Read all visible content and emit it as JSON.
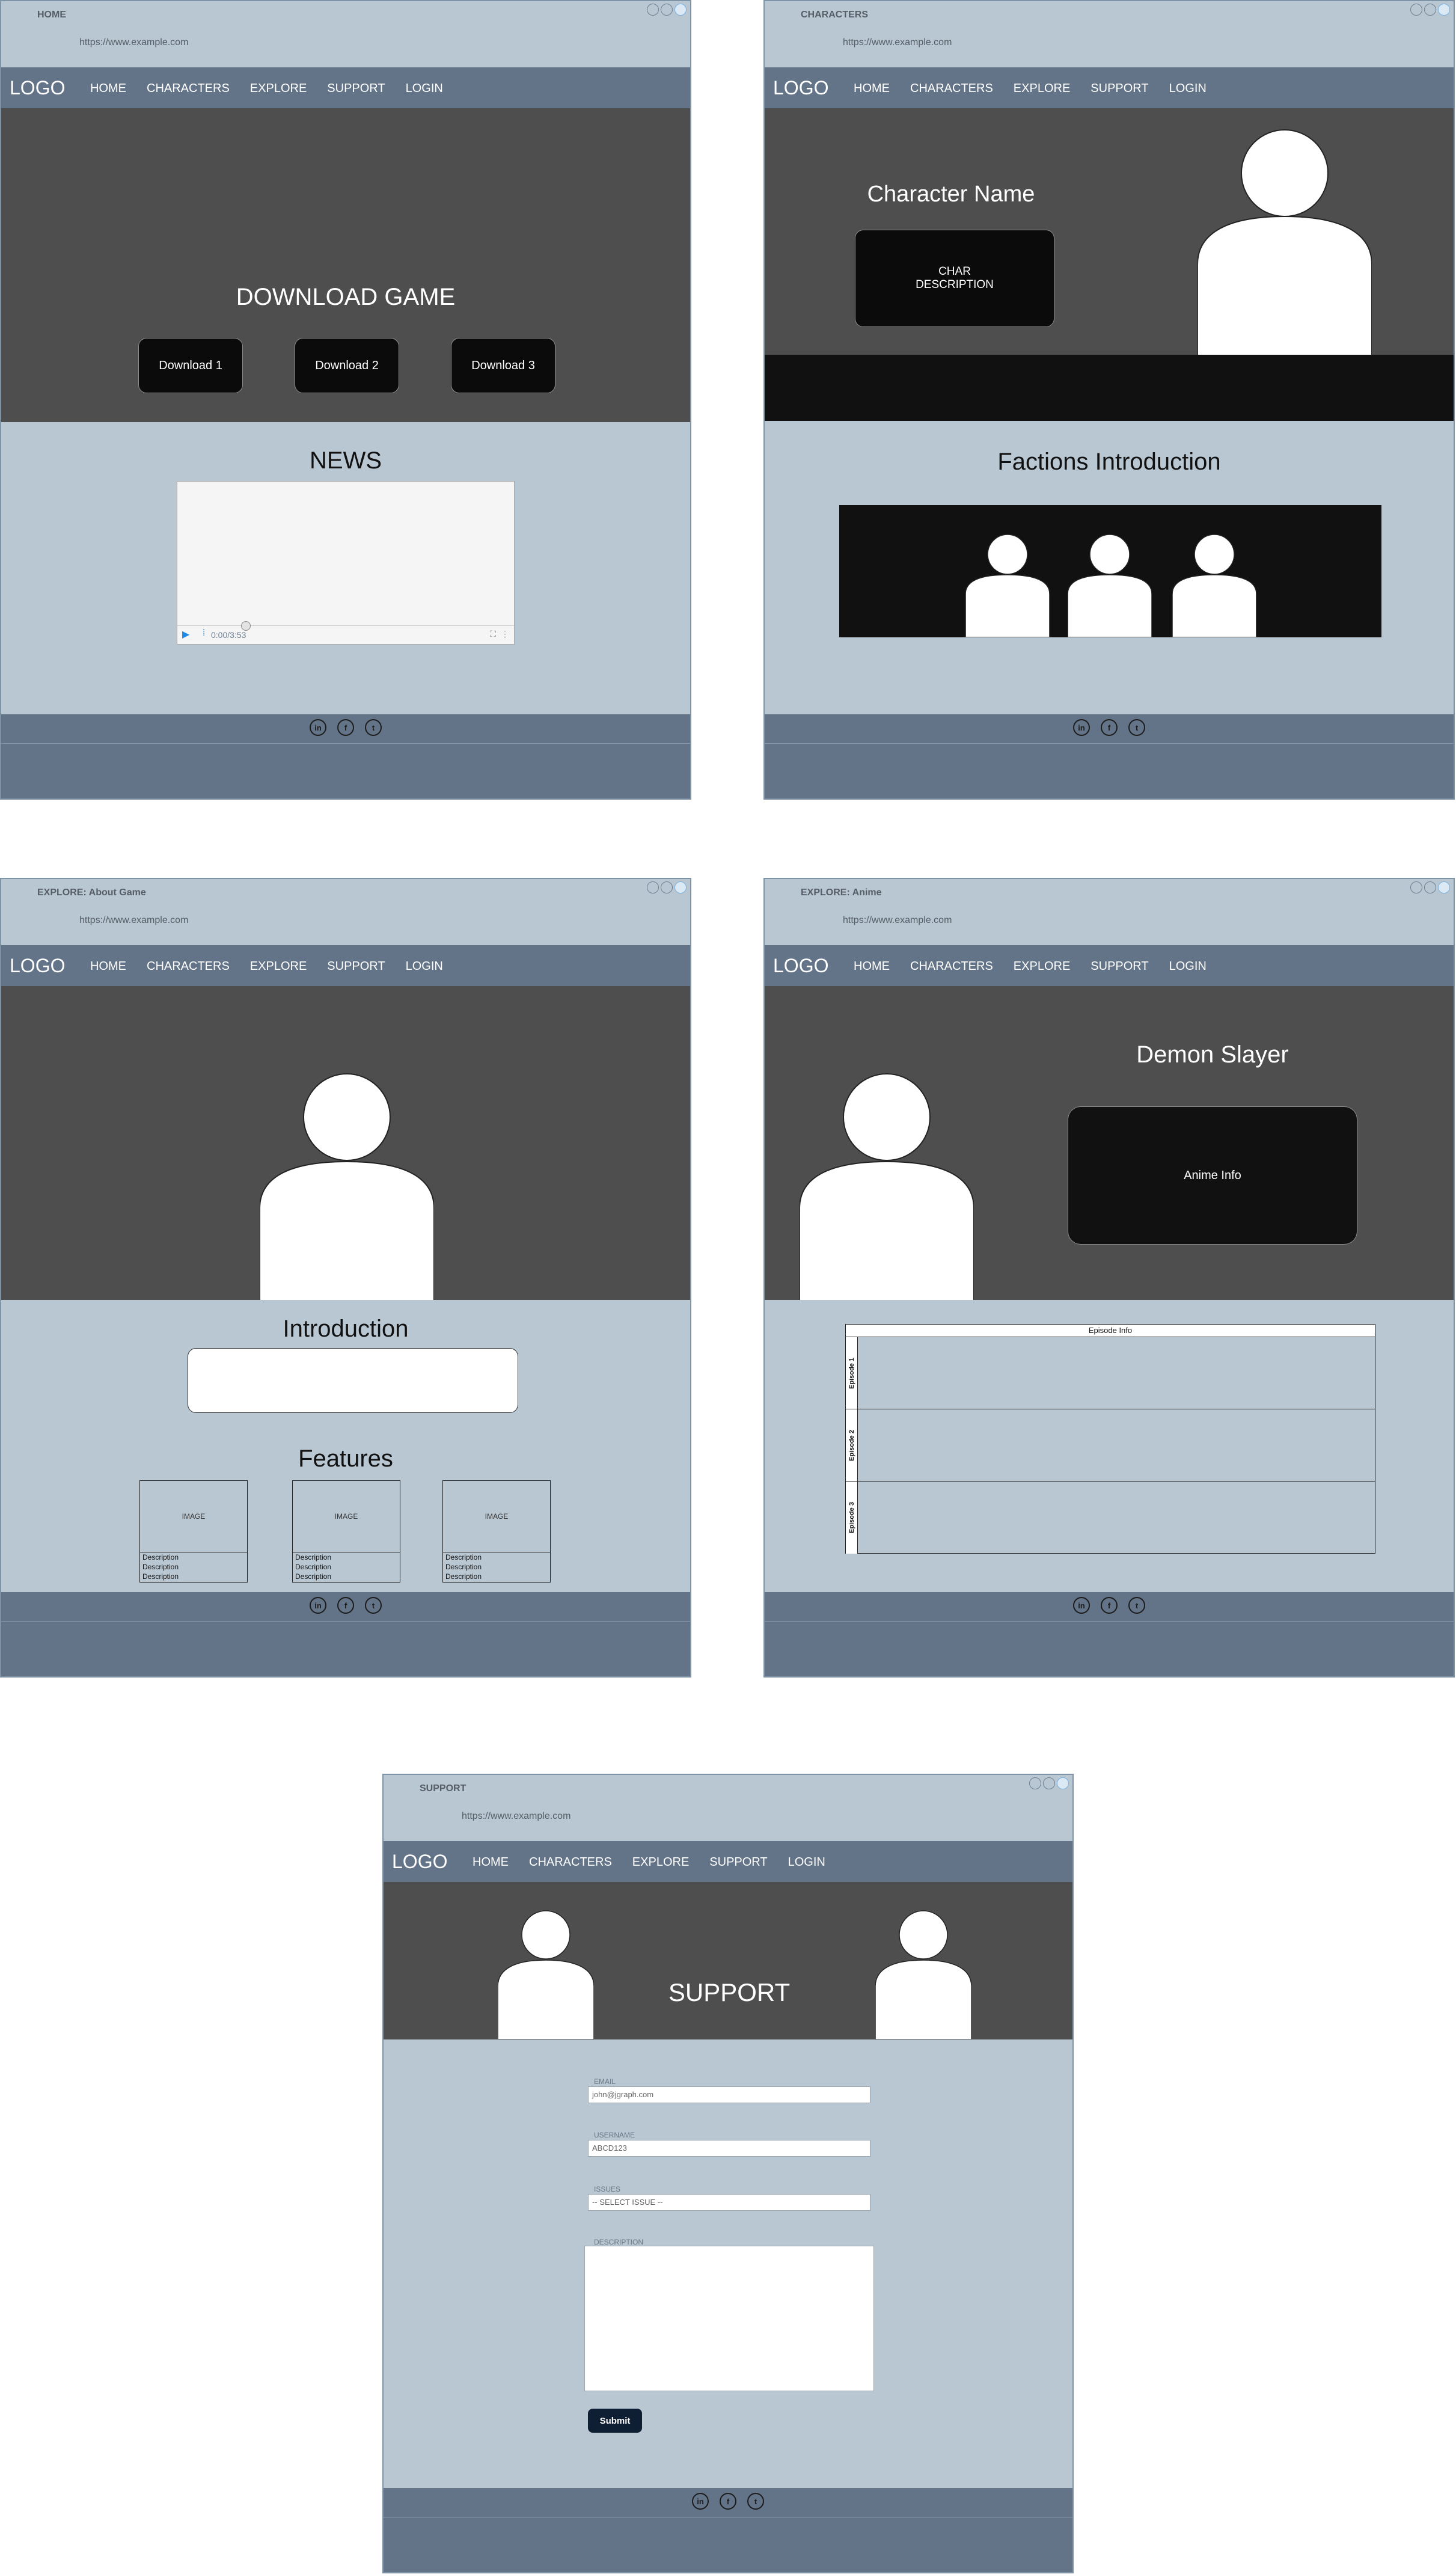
{
  "common": {
    "url": "https://www.example.com",
    "logo": "LOGO",
    "nav": [
      "HOME",
      "CHARACTERS",
      "EXPLORE",
      "SUPPORT",
      "LOGIN"
    ],
    "social": [
      "in",
      "f",
      "t"
    ]
  },
  "home": {
    "title": "HOME",
    "hero_heading": "DOWNLOAD GAME",
    "downloads": [
      "Download 1",
      "Download 2",
      "Download 3"
    ],
    "news_heading": "NEWS",
    "video_time": "0:00/3:53"
  },
  "characters": {
    "title": "CHARACTERS",
    "character_name": "Character Name",
    "char_desc_line1": "CHAR",
    "char_desc_line2": "DESCRIPTION",
    "factions_heading": "Factions Introduction"
  },
  "about": {
    "title": "EXPLORE: About Game",
    "intro_heading": "Introduction",
    "features_heading": "Features",
    "feature_image": "IMAGE",
    "feature_desc": "Description"
  },
  "anime": {
    "title": "EXPLORE: Anime",
    "anime_title": "Demon Slayer",
    "anime_info": "Anime Info",
    "episode_header": "Episode Info",
    "episodes": [
      "Episode 1",
      "Episode 2",
      "Episode 3"
    ]
  },
  "support": {
    "title": "SUPPORT",
    "hero_heading": "SUPPORT",
    "email_label": "EMAIL",
    "email_value": "john@jgraph.com",
    "username_label": "USERNAME",
    "username_value": "ABCD123",
    "issues_label": "ISSUES",
    "issues_value": "-- SELECT ISSUE --",
    "description_label": "DESCRIPTION",
    "submit": "Submit"
  }
}
